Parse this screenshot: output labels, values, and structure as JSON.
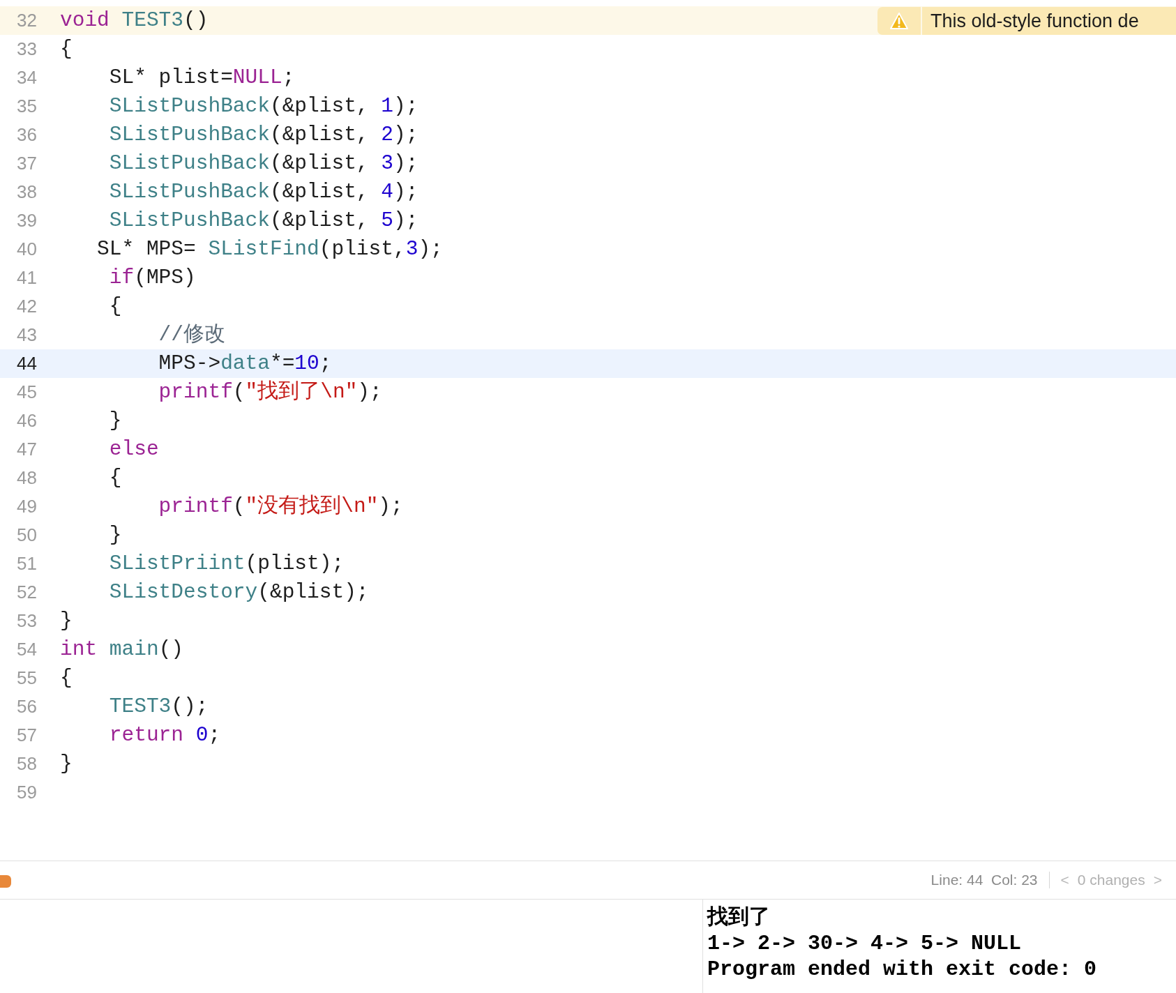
{
  "editor": {
    "lines": [
      {
        "number": "32",
        "current": false,
        "issue": {
          "kind": "warning",
          "message": "This old-style function de"
        },
        "tokens": [
          {
            "kind": "keyword",
            "text": "void "
          },
          {
            "kind": "function",
            "text": "TEST3"
          },
          {
            "kind": "plain",
            "text": "()"
          }
        ]
      },
      {
        "number": "33",
        "current": false,
        "tokens": [
          {
            "kind": "plain",
            "text": "{"
          }
        ]
      },
      {
        "number": "34",
        "current": false,
        "tokens": [
          {
            "kind": "plain",
            "text": "    SL* plist="
          },
          {
            "kind": "keyword",
            "text": "NULL"
          },
          {
            "kind": "plain",
            "text": ";"
          }
        ]
      },
      {
        "number": "35",
        "current": false,
        "tokens": [
          {
            "kind": "function",
            "text": "    SListPushBack"
          },
          {
            "kind": "plain",
            "text": "(&plist, "
          },
          {
            "kind": "number",
            "text": "1"
          },
          {
            "kind": "plain",
            "text": ");"
          }
        ]
      },
      {
        "number": "36",
        "current": false,
        "tokens": [
          {
            "kind": "function",
            "text": "    SListPushBack"
          },
          {
            "kind": "plain",
            "text": "(&plist, "
          },
          {
            "kind": "number",
            "text": "2"
          },
          {
            "kind": "plain",
            "text": ");"
          }
        ]
      },
      {
        "number": "37",
        "current": false,
        "tokens": [
          {
            "kind": "function",
            "text": "    SListPushBack"
          },
          {
            "kind": "plain",
            "text": "(&plist, "
          },
          {
            "kind": "number",
            "text": "3"
          },
          {
            "kind": "plain",
            "text": ");"
          }
        ]
      },
      {
        "number": "38",
        "current": false,
        "tokens": [
          {
            "kind": "function",
            "text": "    SListPushBack"
          },
          {
            "kind": "plain",
            "text": "(&plist, "
          },
          {
            "kind": "number",
            "text": "4"
          },
          {
            "kind": "plain",
            "text": ");"
          }
        ]
      },
      {
        "number": "39",
        "current": false,
        "tokens": [
          {
            "kind": "function",
            "text": "    SListPushBack"
          },
          {
            "kind": "plain",
            "text": "(&plist, "
          },
          {
            "kind": "number",
            "text": "5"
          },
          {
            "kind": "plain",
            "text": ");"
          }
        ]
      },
      {
        "number": "40",
        "current": false,
        "tokens": [
          {
            "kind": "plain",
            "text": "   SL* MPS= "
          },
          {
            "kind": "function",
            "text": "SListFind"
          },
          {
            "kind": "plain",
            "text": "(plist,"
          },
          {
            "kind": "number",
            "text": "3"
          },
          {
            "kind": "plain",
            "text": ");"
          }
        ]
      },
      {
        "number": "41",
        "current": false,
        "tokens": [
          {
            "kind": "keyword",
            "text": "    if"
          },
          {
            "kind": "plain",
            "text": "(MPS)"
          }
        ]
      },
      {
        "number": "42",
        "current": false,
        "tokens": [
          {
            "kind": "plain",
            "text": "    {"
          }
        ]
      },
      {
        "number": "43",
        "current": false,
        "tokens": [
          {
            "kind": "comment",
            "text": "        //修改"
          }
        ]
      },
      {
        "number": "44",
        "current": true,
        "tokens": [
          {
            "kind": "plain",
            "text": "        MPS->"
          },
          {
            "kind": "function",
            "text": "data"
          },
          {
            "kind": "plain",
            "text": "*="
          },
          {
            "kind": "number",
            "text": "10"
          },
          {
            "kind": "plain",
            "text": ";"
          }
        ]
      },
      {
        "number": "45",
        "current": false,
        "tokens": [
          {
            "kind": "keyword",
            "text": "        printf"
          },
          {
            "kind": "plain",
            "text": "("
          },
          {
            "kind": "string",
            "text": "\"找到了\\n\""
          },
          {
            "kind": "plain",
            "text": ");"
          }
        ]
      },
      {
        "number": "46",
        "current": false,
        "tokens": [
          {
            "kind": "plain",
            "text": "    }"
          }
        ]
      },
      {
        "number": "47",
        "current": false,
        "tokens": [
          {
            "kind": "keyword",
            "text": "    else"
          }
        ]
      },
      {
        "number": "48",
        "current": false,
        "tokens": [
          {
            "kind": "plain",
            "text": "    {"
          }
        ]
      },
      {
        "number": "49",
        "current": false,
        "tokens": [
          {
            "kind": "keyword",
            "text": "        printf"
          },
          {
            "kind": "plain",
            "text": "("
          },
          {
            "kind": "string",
            "text": "\"没有找到\\n\""
          },
          {
            "kind": "plain",
            "text": ");"
          }
        ]
      },
      {
        "number": "50",
        "current": false,
        "tokens": [
          {
            "kind": "plain",
            "text": "    }"
          }
        ]
      },
      {
        "number": "51",
        "current": false,
        "tokens": [
          {
            "kind": "function",
            "text": "    SListPriint"
          },
          {
            "kind": "plain",
            "text": "(plist);"
          }
        ]
      },
      {
        "number": "52",
        "current": false,
        "tokens": [
          {
            "kind": "function",
            "text": "    SListDestory"
          },
          {
            "kind": "plain",
            "text": "(&plist);"
          }
        ]
      },
      {
        "number": "53",
        "current": false,
        "tokens": [
          {
            "kind": "plain",
            "text": "}"
          }
        ]
      },
      {
        "number": "54",
        "current": false,
        "tokens": [
          {
            "kind": "keyword",
            "text": "int "
          },
          {
            "kind": "function",
            "text": "main"
          },
          {
            "kind": "plain",
            "text": "()"
          }
        ]
      },
      {
        "number": "55",
        "current": false,
        "tokens": [
          {
            "kind": "plain",
            "text": "{"
          }
        ]
      },
      {
        "number": "56",
        "current": false,
        "tokens": [
          {
            "kind": "function",
            "text": "    TEST3"
          },
          {
            "kind": "plain",
            "text": "();"
          }
        ]
      },
      {
        "number": "57",
        "current": false,
        "tokens": [
          {
            "kind": "keyword",
            "text": "    return "
          },
          {
            "kind": "number",
            "text": "0"
          },
          {
            "kind": "plain",
            "text": ";"
          }
        ]
      },
      {
        "number": "58",
        "current": false,
        "tokens": [
          {
            "kind": "plain",
            "text": "}"
          }
        ]
      },
      {
        "number": "59",
        "current": false
      }
    ]
  },
  "status_bar": {
    "position": "Line: 44  Col: 23",
    "prev": "<",
    "changes": "0 changes",
    "next": ">"
  },
  "console": {
    "output": [
      "找到了",
      "1-> 2-> 30-> 4-> 5-> NULL",
      "Program ended with exit code: 0"
    ]
  }
}
